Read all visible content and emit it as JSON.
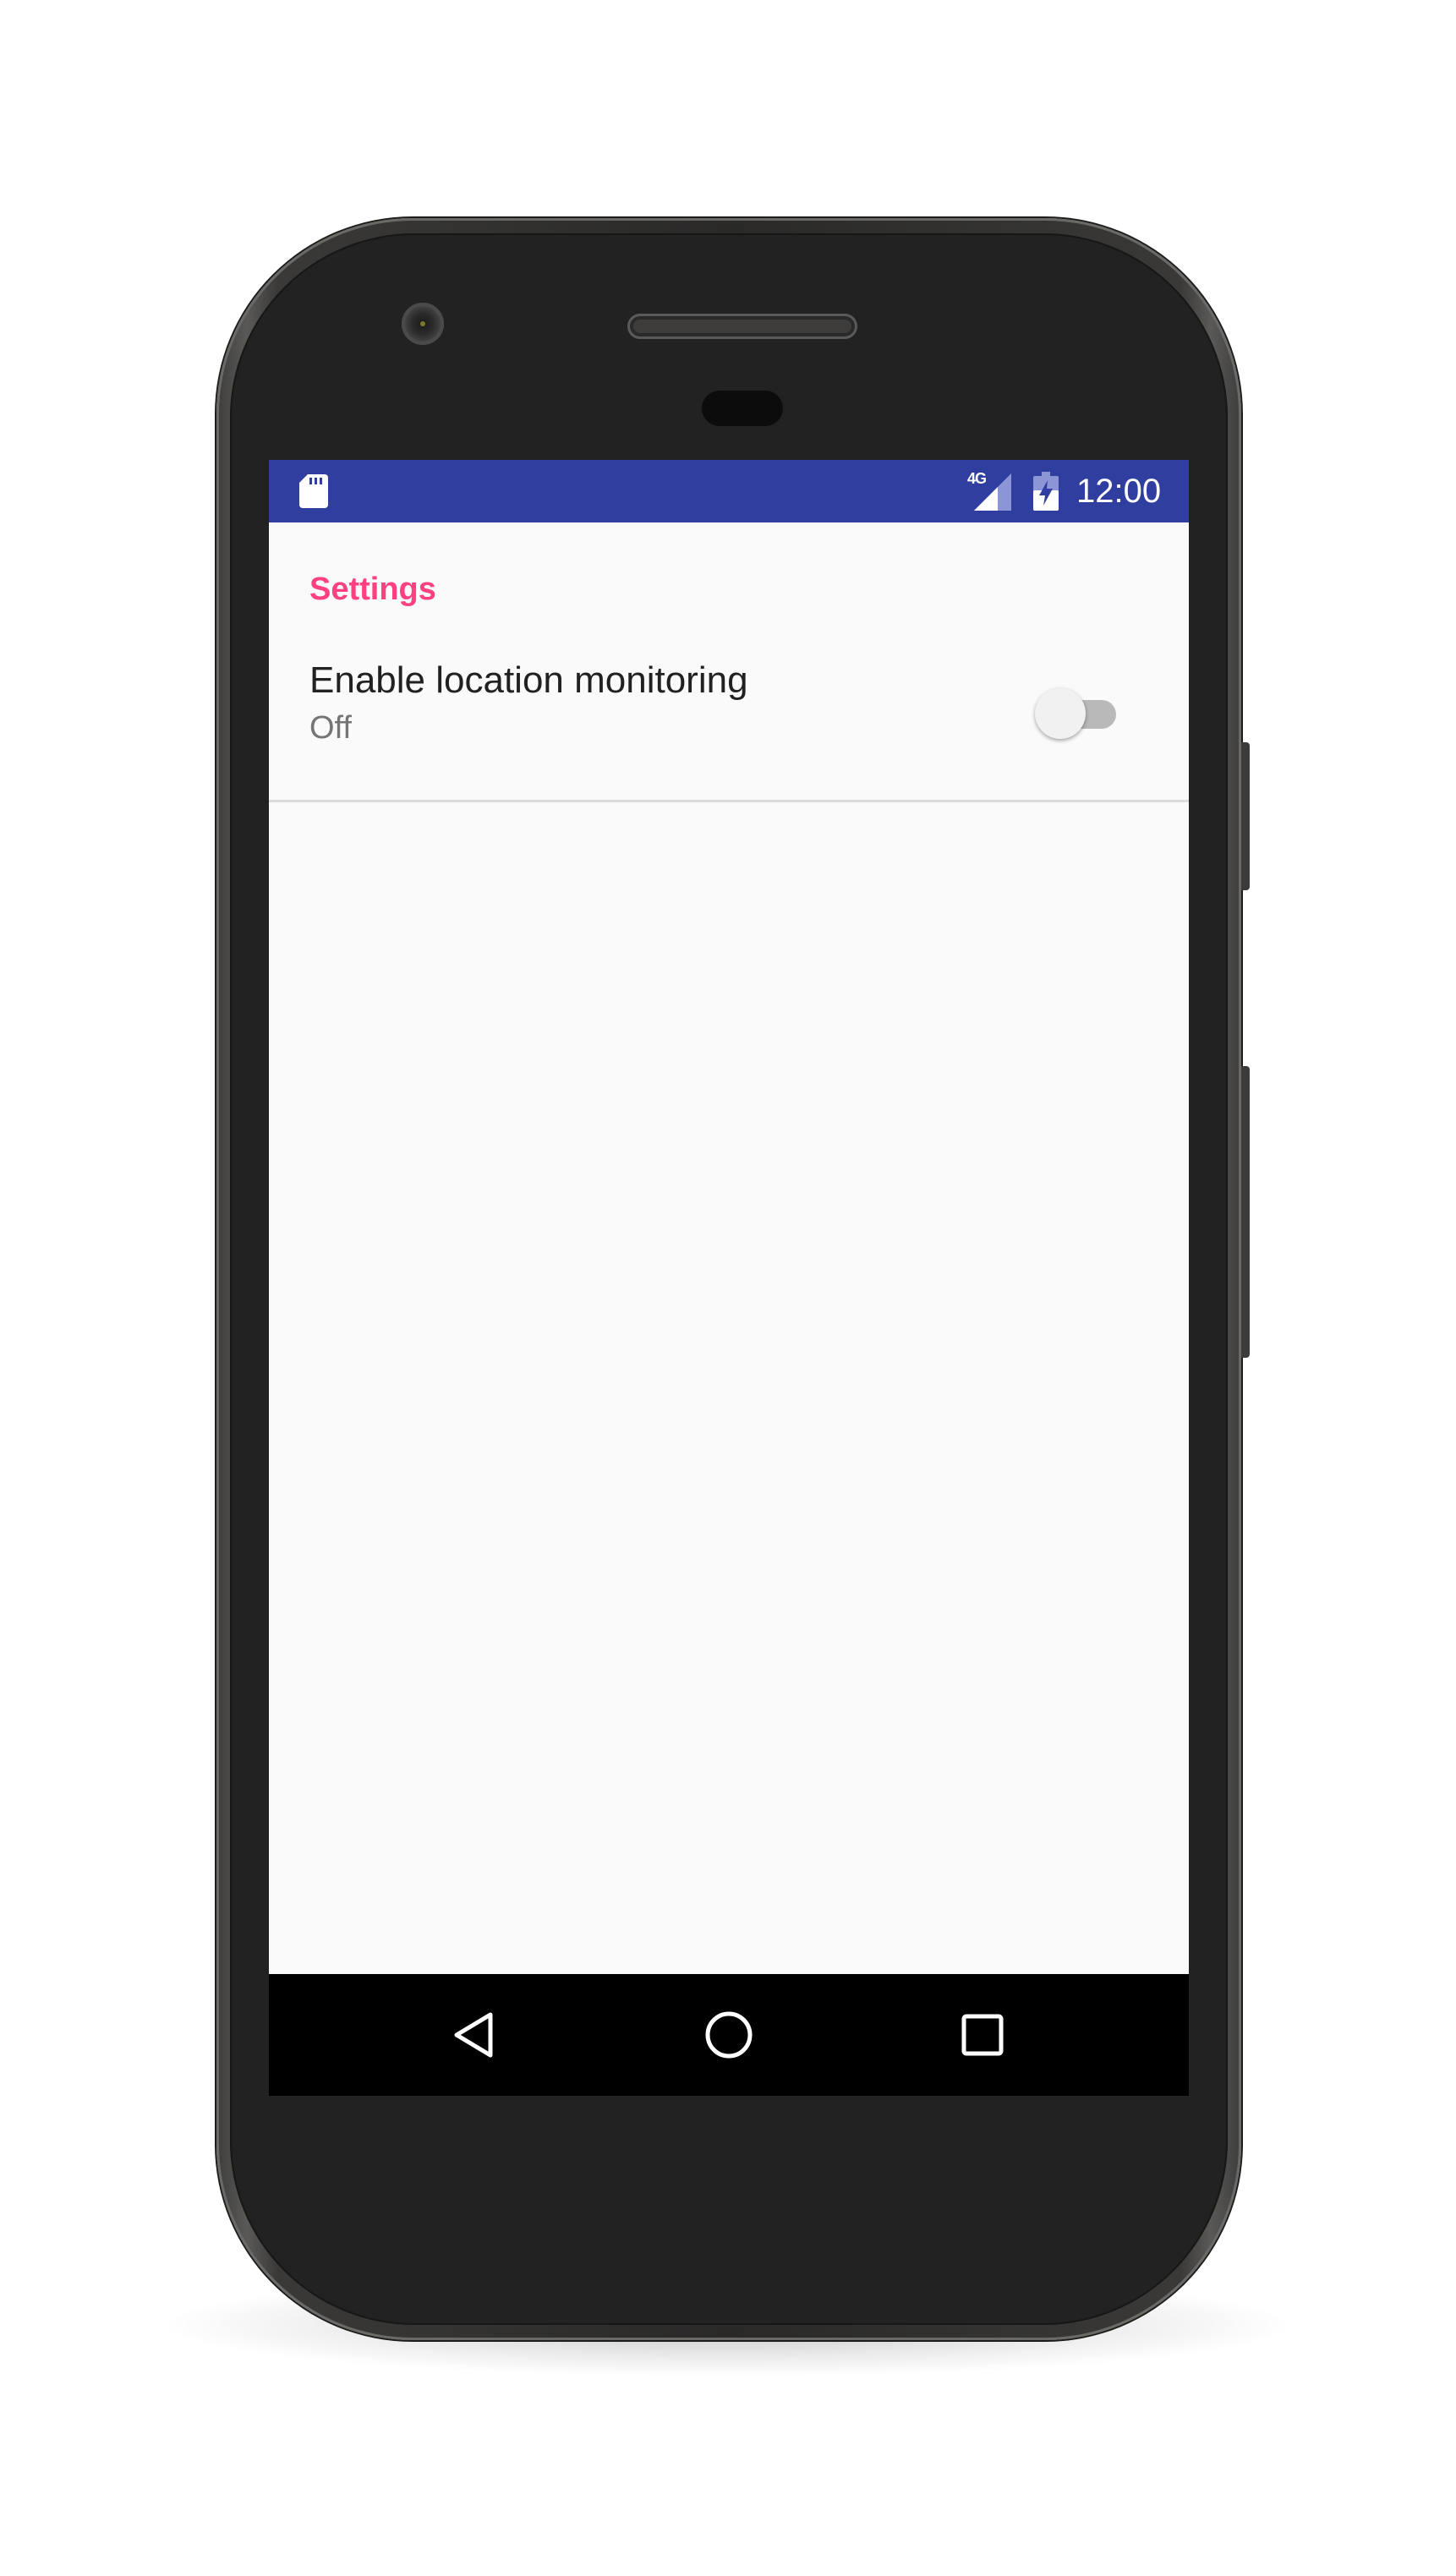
{
  "status_bar": {
    "network_type": "4G",
    "time": "12:00",
    "icons": [
      "sd-card-icon",
      "signal-icon",
      "battery-charging-icon"
    ],
    "background_color": "#303f9f"
  },
  "settings": {
    "category_title": "Settings",
    "category_color": "#ff4081",
    "preferences": [
      {
        "title": "Enable location monitoring",
        "summary": "Off",
        "switch_on": false
      }
    ]
  },
  "nav_bar": {
    "buttons": [
      "back-icon",
      "home-icon",
      "recents-icon"
    ]
  }
}
